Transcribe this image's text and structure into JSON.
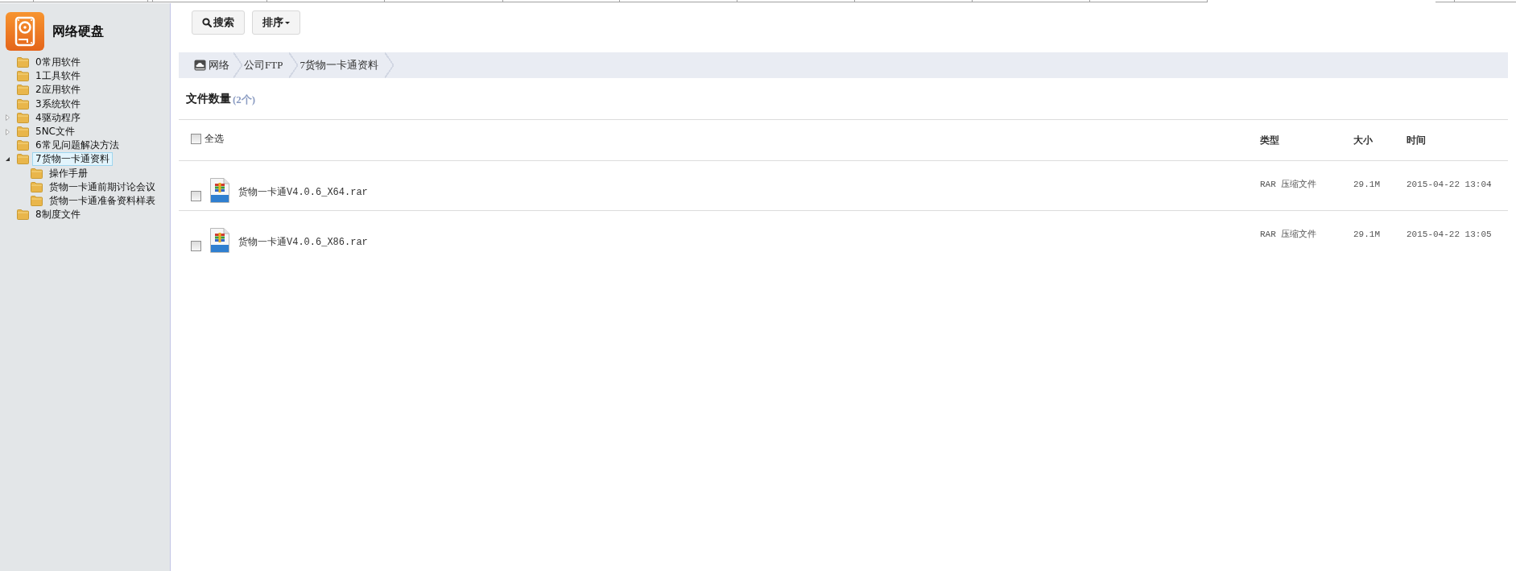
{
  "sidebar": {
    "title": "网络硬盘",
    "tree": [
      {
        "label": "0常用软件",
        "expandable": false,
        "selected": false
      },
      {
        "label": "1工具软件",
        "expandable": false,
        "selected": false
      },
      {
        "label": "2应用软件",
        "expandable": false,
        "selected": false
      },
      {
        "label": "3系统软件",
        "expandable": false,
        "selected": false
      },
      {
        "label": "4驱动程序",
        "expandable": true,
        "expanded": false,
        "selected": false
      },
      {
        "label": "5NC文件",
        "expandable": true,
        "expanded": false,
        "selected": false
      },
      {
        "label": "6常见问题解决方法",
        "expandable": false,
        "selected": false
      },
      {
        "label": "7货物一卡通资料",
        "expandable": true,
        "expanded": true,
        "selected": true,
        "children": [
          {
            "label": "操作手册",
            "selected": false
          },
          {
            "label": "货物一卡通前期讨论会议",
            "selected": false
          },
          {
            "label": "货物一卡通准备资料样表",
            "selected": false
          }
        ]
      },
      {
        "label": "8制度文件",
        "expandable": false,
        "selected": false
      }
    ]
  },
  "toolbar": {
    "buttons": [
      {
        "kind": "search",
        "label": "搜索"
      },
      {
        "kind": "menu",
        "label": "排序"
      }
    ]
  },
  "breadcrumb": [
    "网络",
    "公司FTP",
    "7货物一卡通资料"
  ],
  "summary": {
    "label": "文件数量",
    "count": "(2个)"
  },
  "file_table": {
    "select_all": {
      "label": "全选",
      "checked": false
    },
    "columns": [
      "类型",
      "大小",
      "时间"
    ],
    "rows": [
      {
        "name": "货物一卡通V4.0.6_X64.rar",
        "type": "RAR 压缩文件",
        "size": "29.1M",
        "time": "2015-04-22 13:04",
        "checked": false
      },
      {
        "name": "货物一卡通V4.0.6_X86.rar",
        "type": "RAR 压缩文件",
        "size": "29.1M",
        "time": "2015-04-22 13:05",
        "checked": false
      }
    ]
  }
}
